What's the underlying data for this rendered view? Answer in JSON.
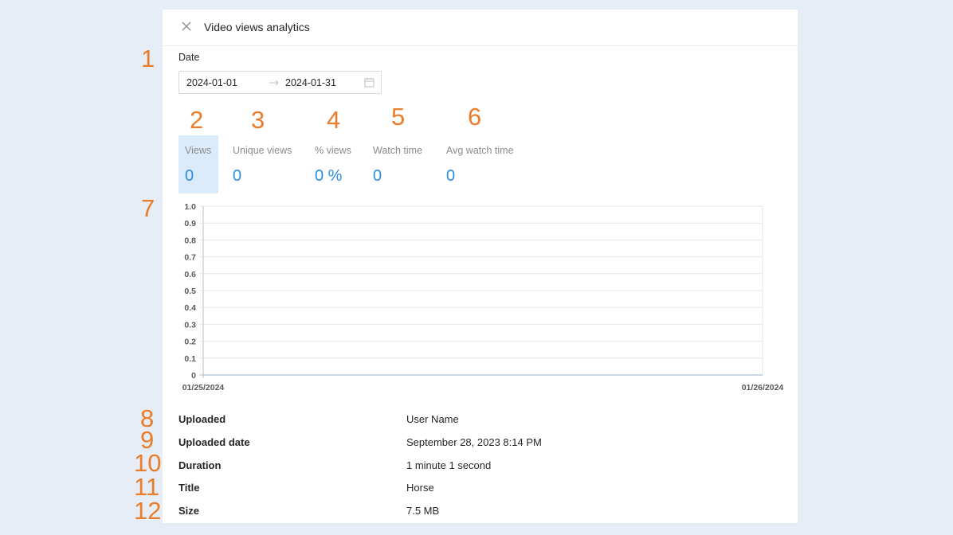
{
  "panel": {
    "title": "Video views analytics",
    "close_icon": "close-icon"
  },
  "date": {
    "label": "Date",
    "start": "2024-01-01",
    "end": "2024-01-31",
    "separator_icon": "arrow-right-icon",
    "calendar_icon": "calendar-icon"
  },
  "stats": [
    {
      "label": "Views",
      "value": "0",
      "active": true
    },
    {
      "label": "Unique views",
      "value": "0",
      "active": false
    },
    {
      "label": "% views",
      "value": "0 %",
      "active": false
    },
    {
      "label": "Watch time",
      "value": "0",
      "active": false
    },
    {
      "label": "Avg watch time",
      "value": "0",
      "active": false
    }
  ],
  "chart_data": {
    "type": "line",
    "title": "",
    "xlabel": "",
    "ylabel": "",
    "x": [
      "01/25/2024",
      "01/26/2024"
    ],
    "series": [
      {
        "values": [
          0,
          0
        ]
      }
    ],
    "ylim": [
      0,
      1.0
    ],
    "yticks": [
      "0",
      "0.1",
      "0.2",
      "0.3",
      "0.4",
      "0.5",
      "0.6",
      "0.7",
      "0.8",
      "0.9",
      "1.0"
    ],
    "grid": true,
    "colors": {
      "grid": "#e6e6e6",
      "axis": "#bfbfbf"
    }
  },
  "details": [
    {
      "key": "Uploaded",
      "value": "User Name"
    },
    {
      "key": "Uploaded date",
      "value": "September 28, 2023 8:14 PM"
    },
    {
      "key": "Duration",
      "value": "1 minute 1 second"
    },
    {
      "key": "Title",
      "value": "Horse"
    },
    {
      "key": "Size",
      "value": "7.5 MB"
    }
  ],
  "markers": [
    "1",
    "2",
    "3",
    "4",
    "5",
    "6",
    "7",
    "8",
    "9",
    "10",
    "11",
    "12"
  ],
  "colors": {
    "accent": "#2a8ee6",
    "marker": "#ea7c2a",
    "active_tab": "#dcebfb"
  }
}
